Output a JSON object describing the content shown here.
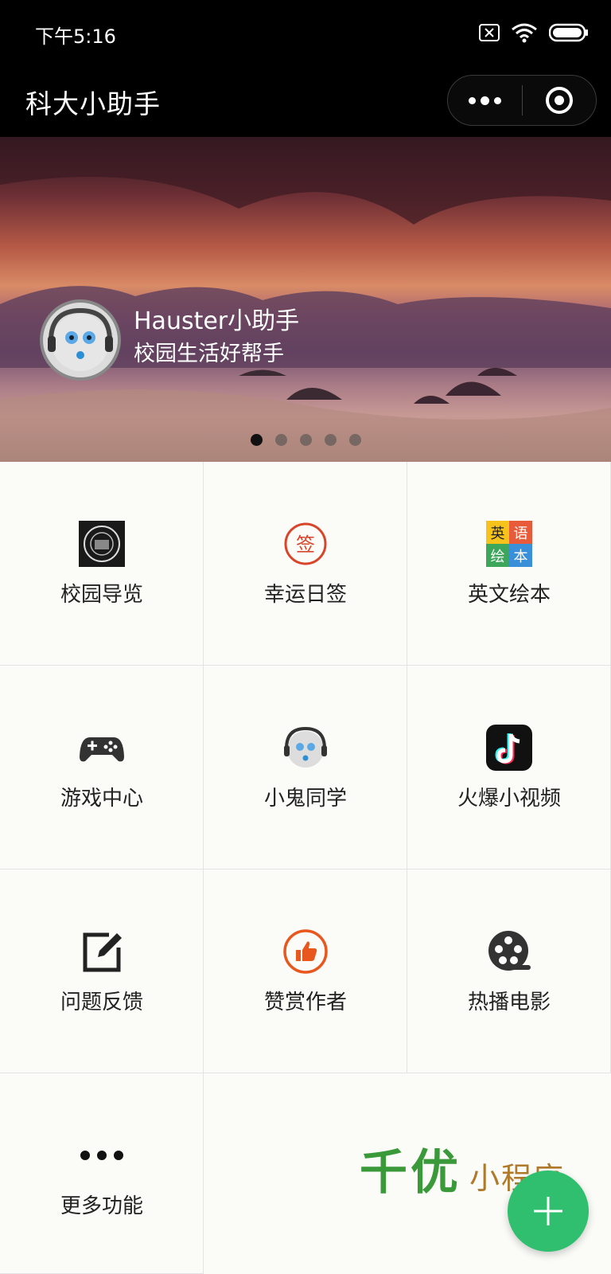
{
  "status_bar": {
    "time": "下午5:16"
  },
  "nav": {
    "title": "科大小助手"
  },
  "banner": {
    "name": "Hauster小助手",
    "subtitle": "校园生活好帮手",
    "page_count": 5,
    "active_page": 1
  },
  "grid": {
    "items": [
      {
        "label": "校园导览",
        "icon": "campus-guide-icon"
      },
      {
        "label": "幸运日签",
        "icon": "daily-sign-icon"
      },
      {
        "label": "英文绘本",
        "icon": "english-picture-book-icon"
      },
      {
        "label": "游戏中心",
        "icon": "gamepad-icon"
      },
      {
        "label": "小鬼同学",
        "icon": "robot-mascot-icon"
      },
      {
        "label": "火爆小视频",
        "icon": "tiktok-icon"
      },
      {
        "label": "问题反馈",
        "icon": "edit-icon"
      },
      {
        "label": "赞赏作者",
        "icon": "thumbs-up-icon"
      },
      {
        "label": "热播电影",
        "icon": "film-reel-icon"
      },
      {
        "label": "更多功能",
        "icon": "more-dots-icon"
      }
    ],
    "sign_icon_char": "签",
    "book_icon_chars": [
      "英",
      "语",
      "绘",
      "本"
    ]
  },
  "watermark": {
    "big": "千优",
    "small": "小程序"
  },
  "colors": {
    "bar_bg": "#000000",
    "accent_green": "#2fbf6e",
    "sign_red": "#d9452a",
    "thumb_orange": "#e8571e"
  }
}
